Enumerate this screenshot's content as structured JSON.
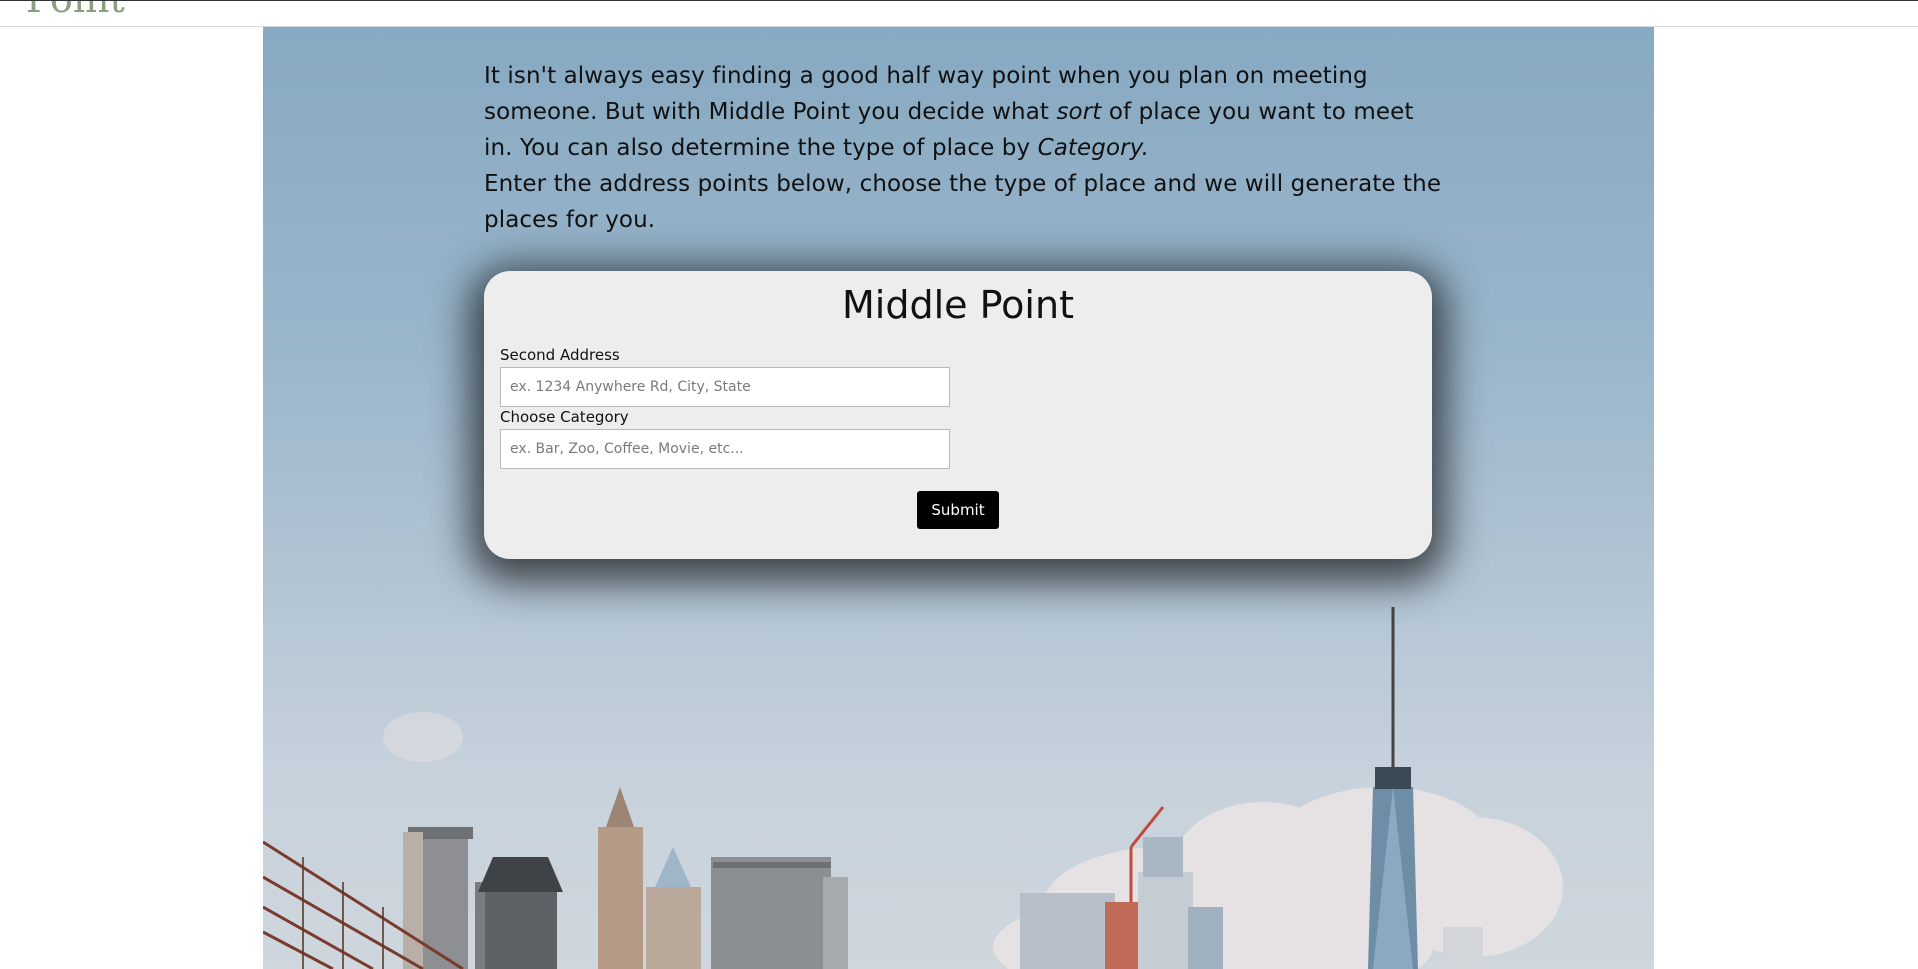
{
  "brand": {
    "text": "Point"
  },
  "intro": {
    "line1": "It isn't always easy finding a good half way point when you plan on meeting someone. But with Middle Point you decide what ",
    "emph1": "sort",
    "line2": " of place you want to meet in. You can also determine the type of place by ",
    "emph2": "Category.",
    "line3": "Enter the address points below, choose the type of place and we will generate the places for you."
  },
  "form": {
    "title": "Middle Point",
    "second_address_label": "Second Address",
    "second_address_placeholder": "ex. 1234 Anywhere Rd, City, State",
    "category_label": "Choose Category",
    "category_placeholder": "ex. Bar, Zoo, Coffee, Movie, etc...",
    "submit_label": "Submit"
  },
  "colors": {
    "brand": "#8a9f7e",
    "sky_top": "#87a9c2",
    "card_bg": "#ededed",
    "button_bg": "#000000"
  }
}
